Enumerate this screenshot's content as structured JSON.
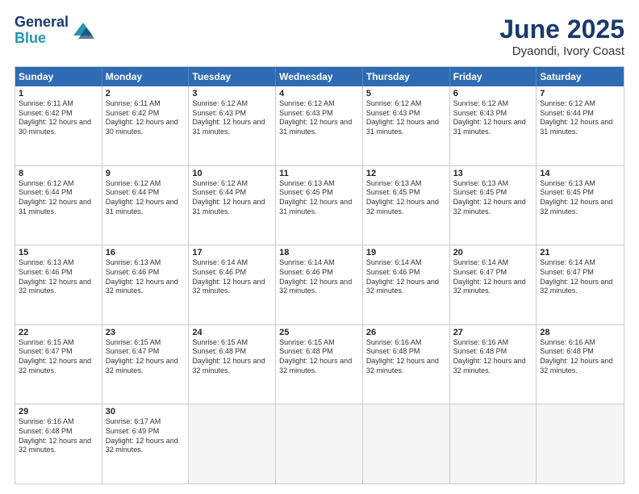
{
  "header": {
    "logo_line1": "General",
    "logo_line2": "Blue",
    "title": "June 2025",
    "subtitle": "Dyaondi, Ivory Coast"
  },
  "calendar": {
    "days": [
      "Sunday",
      "Monday",
      "Tuesday",
      "Wednesday",
      "Thursday",
      "Friday",
      "Saturday"
    ],
    "rows": [
      [
        {
          "day": "",
          "empty": true
        },
        {
          "day": "2",
          "sunrise": "6:11 AM",
          "sunset": "6:42 PM",
          "daylight": "12 hours and 30 minutes."
        },
        {
          "day": "3",
          "sunrise": "6:12 AM",
          "sunset": "6:43 PM",
          "daylight": "12 hours and 31 minutes."
        },
        {
          "day": "4",
          "sunrise": "6:12 AM",
          "sunset": "6:43 PM",
          "daylight": "12 hours and 31 minutes."
        },
        {
          "day": "5",
          "sunrise": "6:12 AM",
          "sunset": "6:43 PM",
          "daylight": "12 hours and 31 minutes."
        },
        {
          "day": "6",
          "sunrise": "6:12 AM",
          "sunset": "6:43 PM",
          "daylight": "12 hours and 31 minutes."
        },
        {
          "day": "7",
          "sunrise": "6:12 AM",
          "sunset": "6:44 PM",
          "daylight": "12 hours and 31 minutes."
        }
      ],
      [
        {
          "day": "1",
          "sunrise": "6:11 AM",
          "sunset": "6:42 PM",
          "daylight": "12 hours and 30 minutes."
        },
        {
          "day": "9",
          "sunrise": "6:12 AM",
          "sunset": "6:44 PM",
          "daylight": "12 hours and 31 minutes."
        },
        {
          "day": "10",
          "sunrise": "6:12 AM",
          "sunset": "6:44 PM",
          "daylight": "12 hours and 31 minutes."
        },
        {
          "day": "11",
          "sunrise": "6:13 AM",
          "sunset": "6:45 PM",
          "daylight": "12 hours and 31 minutes."
        },
        {
          "day": "12",
          "sunrise": "6:13 AM",
          "sunset": "6:45 PM",
          "daylight": "12 hours and 32 minutes."
        },
        {
          "day": "13",
          "sunrise": "6:13 AM",
          "sunset": "6:45 PM",
          "daylight": "12 hours and 32 minutes."
        },
        {
          "day": "14",
          "sunrise": "6:13 AM",
          "sunset": "6:45 PM",
          "daylight": "12 hours and 32 minutes."
        }
      ],
      [
        {
          "day": "8",
          "sunrise": "6:12 AM",
          "sunset": "6:44 PM",
          "daylight": "12 hours and 31 minutes."
        },
        {
          "day": "16",
          "sunrise": "6:13 AM",
          "sunset": "6:46 PM",
          "daylight": "12 hours and 32 minutes."
        },
        {
          "day": "17",
          "sunrise": "6:14 AM",
          "sunset": "6:46 PM",
          "daylight": "12 hours and 32 minutes."
        },
        {
          "day": "18",
          "sunrise": "6:14 AM",
          "sunset": "6:46 PM",
          "daylight": "12 hours and 32 minutes."
        },
        {
          "day": "19",
          "sunrise": "6:14 AM",
          "sunset": "6:46 PM",
          "daylight": "12 hours and 32 minutes."
        },
        {
          "day": "20",
          "sunrise": "6:14 AM",
          "sunset": "6:47 PM",
          "daylight": "12 hours and 32 minutes."
        },
        {
          "day": "21",
          "sunrise": "6:14 AM",
          "sunset": "6:47 PM",
          "daylight": "12 hours and 32 minutes."
        }
      ],
      [
        {
          "day": "15",
          "sunrise": "6:13 AM",
          "sunset": "6:46 PM",
          "daylight": "12 hours and 32 minutes."
        },
        {
          "day": "23",
          "sunrise": "6:15 AM",
          "sunset": "6:47 PM",
          "daylight": "12 hours and 32 minutes."
        },
        {
          "day": "24",
          "sunrise": "6:15 AM",
          "sunset": "6:48 PM",
          "daylight": "12 hours and 32 minutes."
        },
        {
          "day": "25",
          "sunrise": "6:15 AM",
          "sunset": "6:48 PM",
          "daylight": "12 hours and 32 minutes."
        },
        {
          "day": "26",
          "sunrise": "6:16 AM",
          "sunset": "6:48 PM",
          "daylight": "12 hours and 32 minutes."
        },
        {
          "day": "27",
          "sunrise": "6:16 AM",
          "sunset": "6:48 PM",
          "daylight": "12 hours and 32 minutes."
        },
        {
          "day": "28",
          "sunrise": "6:16 AM",
          "sunset": "6:48 PM",
          "daylight": "12 hours and 32 minutes."
        }
      ],
      [
        {
          "day": "22",
          "sunrise": "6:15 AM",
          "sunset": "6:47 PM",
          "daylight": "12 hours and 32 minutes."
        },
        {
          "day": "30",
          "sunrise": "6:17 AM",
          "sunset": "6:49 PM",
          "daylight": "12 hours and 32 minutes."
        },
        {
          "day": "",
          "empty": true
        },
        {
          "day": "",
          "empty": true
        },
        {
          "day": "",
          "empty": true
        },
        {
          "day": "",
          "empty": true
        },
        {
          "day": "",
          "empty": true
        }
      ],
      [
        {
          "day": "29",
          "sunrise": "6:16 AM",
          "sunset": "6:48 PM",
          "daylight": "12 hours and 32 minutes."
        },
        {
          "day": "",
          "empty": true
        },
        {
          "day": "",
          "empty": true
        },
        {
          "day": "",
          "empty": true
        },
        {
          "day": "",
          "empty": true
        },
        {
          "day": "",
          "empty": true
        },
        {
          "day": "",
          "empty": true
        }
      ]
    ]
  }
}
